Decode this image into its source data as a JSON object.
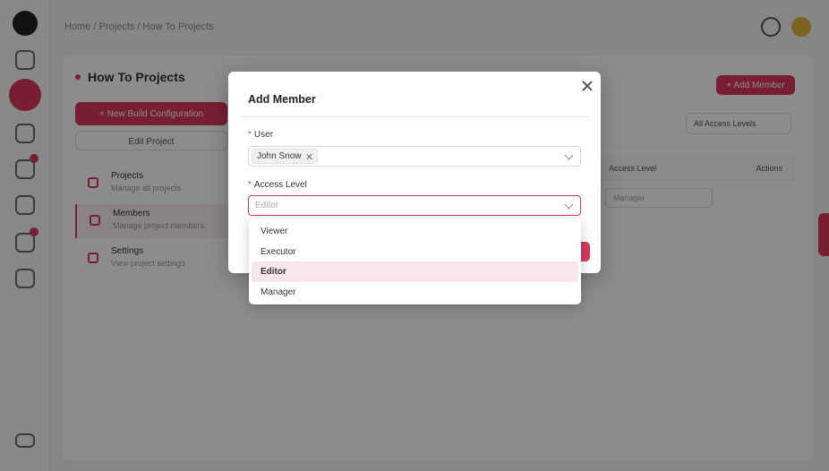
{
  "background": {
    "breadcrumb": "Home / Projects / How To Projects",
    "project_title": "How To Projects",
    "new_build_button": "+ New Build Configuration",
    "edit_project_button": "Edit Project",
    "add_member_button": "+ Add Member",
    "filter_label": "All Access Levels",
    "menu": [
      {
        "title": "Projects",
        "subtitle": "Manage all projects"
      },
      {
        "title": "Members",
        "subtitle": "Manage project members"
      },
      {
        "title": "Settings",
        "subtitle": "View project settings"
      }
    ],
    "table_headers": [
      "Access Level",
      "Actions"
    ],
    "table_cell_value": "Manager"
  },
  "modal": {
    "title": "Add Member",
    "user_label": "User",
    "user_tag": "John Snow",
    "access_label": "Access Level",
    "access_placeholder": "Editor"
  },
  "dropdown": {
    "options": [
      "Viewer",
      "Executor",
      "Editor",
      "Manager"
    ],
    "selected_index": 2
  },
  "colors": {
    "accent": "#d9385e",
    "selected_option_bg": "#f9e6ea"
  }
}
